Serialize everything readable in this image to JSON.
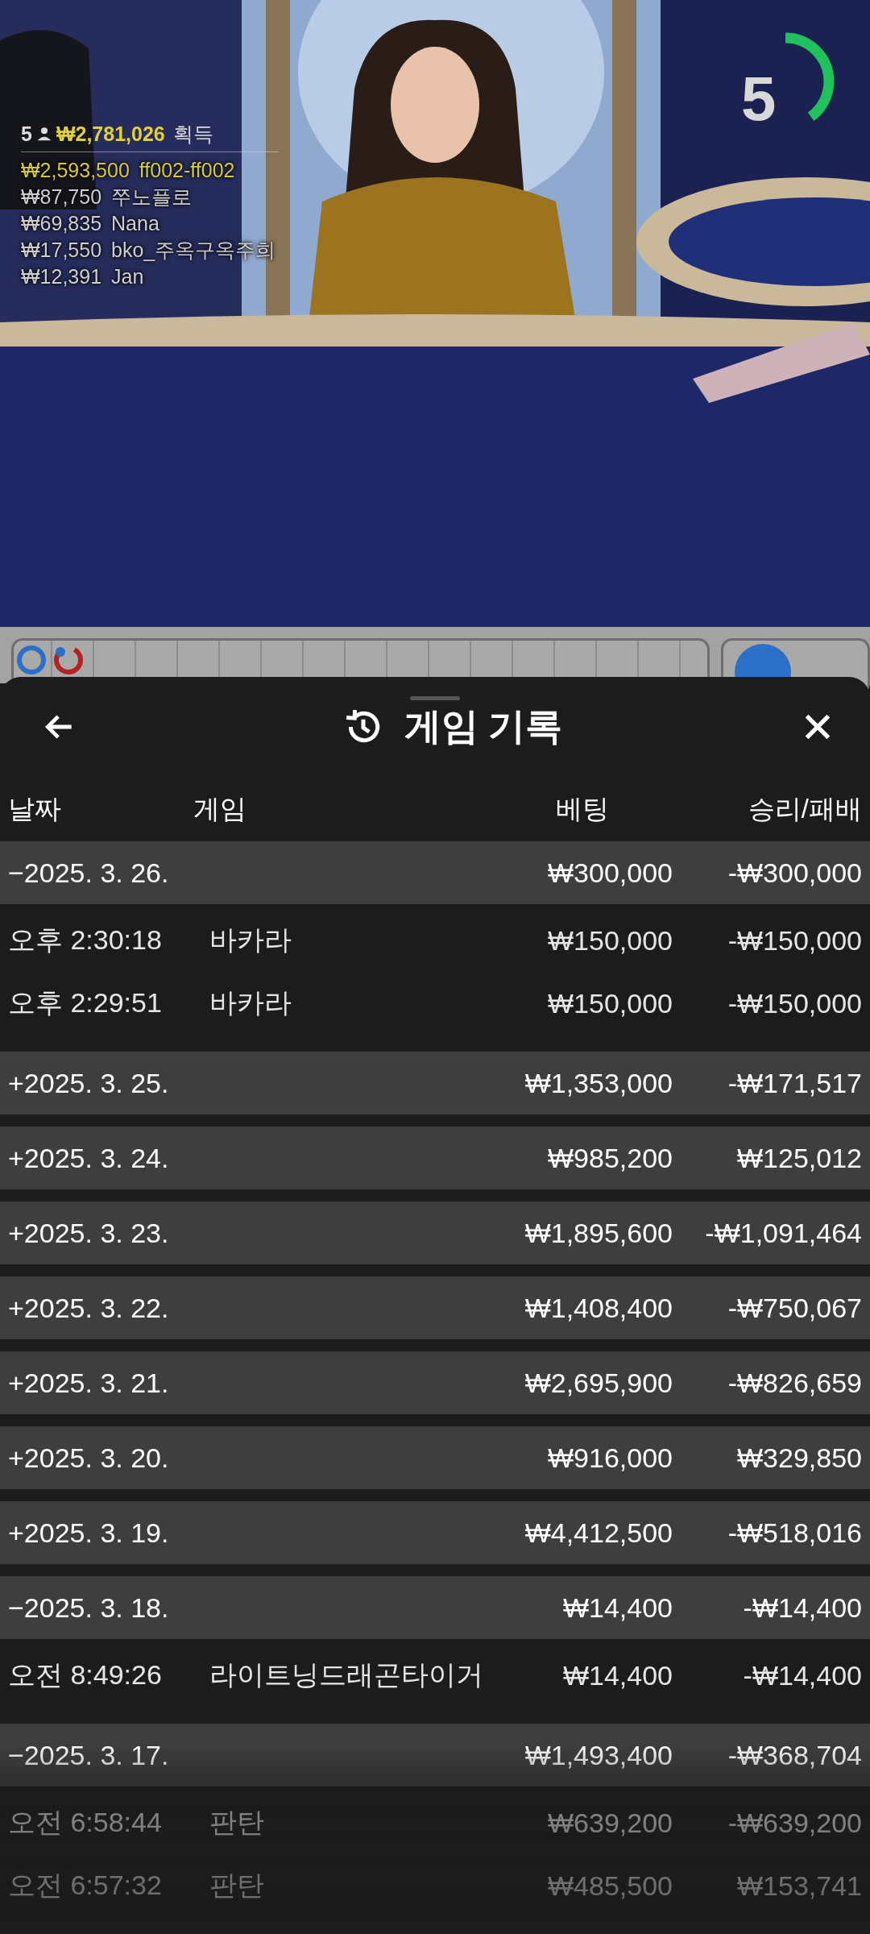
{
  "video": {
    "kind": "picture",
    "round_total": {
      "count": "5",
      "amount": "₩2,781,026",
      "label": "획득"
    },
    "winners": [
      {
        "amount": "₩2,593,500",
        "name": "ff002-ff002",
        "highlighted": true
      },
      {
        "amount": "₩87,750",
        "name": "쭈노플로",
        "highlighted": false
      },
      {
        "amount": "₩69,835",
        "name": "Nana",
        "highlighted": false
      },
      {
        "amount": "₩17,550",
        "name": "bko_주옥구옥주희",
        "highlighted": false
      },
      {
        "amount": "₩12,391",
        "name": "Jan",
        "highlighted": false
      }
    ],
    "timer": {
      "value": "5",
      "level": 0.4
    }
  },
  "sheet": {
    "title": "게임 기록",
    "columns": [
      "날짜",
      "게임",
      "베팅",
      "승리/패배"
    ],
    "days": [
      {
        "toggle": "−",
        "date": "2025. 3. 26.",
        "bet": "₩300,000",
        "result": "-₩300,000",
        "games": [
          {
            "time": "오후 2:30:18",
            "game": "바카라",
            "bet": "₩150,000",
            "result": "-₩150,000"
          },
          {
            "time": "오후 2:29:51",
            "game": "바카라",
            "bet": "₩150,000",
            "result": "-₩150,000"
          }
        ]
      },
      {
        "toggle": "+",
        "date": "2025. 3. 25.",
        "bet": "₩1,353,000",
        "result": "-₩171,517"
      },
      {
        "toggle": "+",
        "date": "2025. 3. 24.",
        "bet": "₩985,200",
        "result": "₩125,012"
      },
      {
        "toggle": "+",
        "date": "2025. 3. 23.",
        "bet": "₩1,895,600",
        "result": "-₩1,091,464"
      },
      {
        "toggle": "+",
        "date": "2025. 3. 22.",
        "bet": "₩1,408,400",
        "result": "-₩750,067"
      },
      {
        "toggle": "+",
        "date": "2025. 3. 21.",
        "bet": "₩2,695,900",
        "result": "-₩826,659"
      },
      {
        "toggle": "+",
        "date": "2025. 3. 20.",
        "bet": "₩916,000",
        "result": "₩329,850"
      },
      {
        "toggle": "+",
        "date": "2025. 3. 19.",
        "bet": "₩4,412,500",
        "result": "-₩518,016"
      },
      {
        "toggle": "−",
        "date": "2025. 3. 18.",
        "bet": "₩14,400",
        "result": "-₩14,400",
        "games": [
          {
            "time": "오전 8:49:26",
            "game": "라이트닝드래곤타이거",
            "bet": "₩14,400",
            "result": "-₩14,400"
          }
        ]
      },
      {
        "toggle": "−",
        "date": "2025. 3. 17.",
        "bet": "₩1,493,400",
        "result": "-₩368,704",
        "games": [
          {
            "time": "오전 6:58:44",
            "game": "판탄",
            "bet": "₩639,200",
            "result": "-₩639,200"
          },
          {
            "time": "오전 6:57:32",
            "game": "판탄",
            "bet": "₩485,500",
            "result": "₩153,741"
          }
        ]
      }
    ]
  }
}
